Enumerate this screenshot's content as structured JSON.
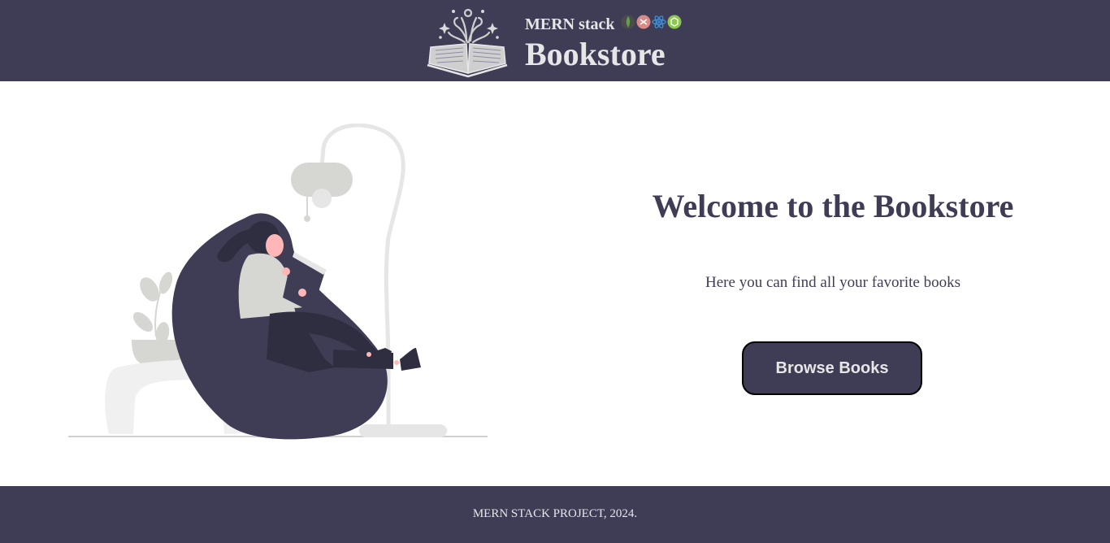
{
  "header": {
    "subtitle": "MERN stack",
    "title": "Bookstore",
    "logo_icon": "open-book-icon",
    "stack_icons": [
      "mongodb-icon",
      "express-icon",
      "react-icon",
      "nodejs-icon"
    ]
  },
  "hero": {
    "heading": "Welcome to the Bookstore",
    "subheading": "Here you can find all your favorite books",
    "button_label": "Browse Books",
    "illustration": "woman-reading-on-beanbag-illustration"
  },
  "footer": {
    "text": "MERN STACK PROJECT, 2024."
  },
  "colors": {
    "primary": "#3f3d56",
    "light_text": "#e6e6e6",
    "background": "#ffffff",
    "button_border": "#000000"
  }
}
